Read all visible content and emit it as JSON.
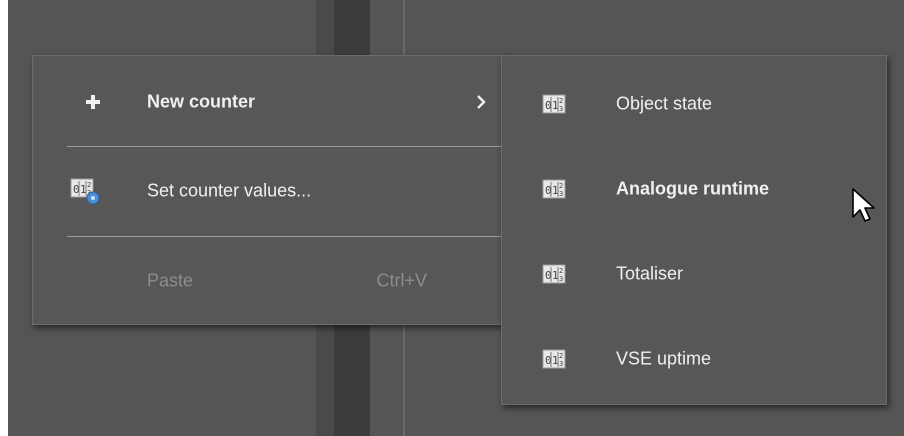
{
  "main_menu": {
    "items": [
      {
        "label": "New counter",
        "icon": "plus-icon",
        "has_submenu": true
      },
      {
        "label": "Set counter values...",
        "icon": "counter-settings-icon"
      },
      {
        "label": "Paste",
        "shortcut": "Ctrl+V",
        "disabled": true
      }
    ]
  },
  "submenu": {
    "items": [
      {
        "label": "Object state",
        "icon": "counter-icon"
      },
      {
        "label": "Analogue runtime",
        "icon": "counter-icon",
        "hovered": true
      },
      {
        "label": "Totaliser",
        "icon": "counter-icon"
      },
      {
        "label": "VSE uptime",
        "icon": "counter-icon"
      }
    ]
  },
  "colors": {
    "background": "#555555",
    "menu": "#575757",
    "text": "#f0f0f0",
    "disabled_text": "#8c8c8c",
    "icon_accent": "#4a90d9"
  }
}
